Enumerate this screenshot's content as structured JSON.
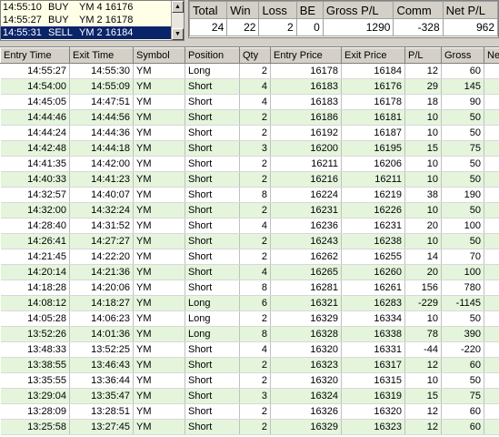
{
  "messages": [
    {
      "time": "14:55:10",
      "side": "BUY",
      "detail": "YM 4 16176",
      "selected": false
    },
    {
      "time": "14:55:27",
      "side": "BUY",
      "detail": "YM 2 16178",
      "selected": false
    },
    {
      "time": "14:55:31",
      "side": "SELL",
      "detail": "YM 2 16184",
      "selected": true
    }
  ],
  "summary": {
    "headers": [
      "Total",
      "Win",
      "Loss",
      "BE",
      "Gross P/L",
      "Comm",
      "Net P/L"
    ],
    "values": [
      "24",
      "22",
      "2",
      "0",
      "1290",
      "-328",
      "962"
    ]
  },
  "trades": {
    "columns": [
      "Entry Time",
      "Exit Time",
      "Symbol",
      "Position",
      "Qty",
      "Entry Price",
      "Exit Price",
      "P/L",
      "Gross",
      "Ne"
    ],
    "rows": [
      [
        "14:55:27",
        "14:55:30",
        "YM",
        "Long",
        "2",
        "16178",
        "16184",
        "12",
        "60",
        ""
      ],
      [
        "14:54:00",
        "14:55:09",
        "YM",
        "Short",
        "4",
        "16183",
        "16176",
        "29",
        "145",
        ""
      ],
      [
        "14:45:05",
        "14:47:51",
        "YM",
        "Short",
        "4",
        "16183",
        "16178",
        "18",
        "90",
        ""
      ],
      [
        "14:44:46",
        "14:44:56",
        "YM",
        "Short",
        "2",
        "16186",
        "16181",
        "10",
        "50",
        ""
      ],
      [
        "14:44:24",
        "14:44:36",
        "YM",
        "Short",
        "2",
        "16192",
        "16187",
        "10",
        "50",
        ""
      ],
      [
        "14:42:48",
        "14:44:18",
        "YM",
        "Short",
        "3",
        "16200",
        "16195",
        "15",
        "75",
        ""
      ],
      [
        "14:41:35",
        "14:42:00",
        "YM",
        "Short",
        "2",
        "16211",
        "16206",
        "10",
        "50",
        ""
      ],
      [
        "14:40:33",
        "14:41:23",
        "YM",
        "Short",
        "2",
        "16216",
        "16211",
        "10",
        "50",
        ""
      ],
      [
        "14:32:57",
        "14:40:07",
        "YM",
        "Short",
        "8",
        "16224",
        "16219",
        "38",
        "190",
        ""
      ],
      [
        "14:32:00",
        "14:32:24",
        "YM",
        "Short",
        "2",
        "16231",
        "16226",
        "10",
        "50",
        ""
      ],
      [
        "14:28:40",
        "14:31:52",
        "YM",
        "Short",
        "4",
        "16236",
        "16231",
        "20",
        "100",
        ""
      ],
      [
        "14:26:41",
        "14:27:27",
        "YM",
        "Short",
        "2",
        "16243",
        "16238",
        "10",
        "50",
        ""
      ],
      [
        "14:21:45",
        "14:22:20",
        "YM",
        "Short",
        "2",
        "16262",
        "16255",
        "14",
        "70",
        ""
      ],
      [
        "14:20:14",
        "14:21:36",
        "YM",
        "Short",
        "4",
        "16265",
        "16260",
        "20",
        "100",
        ""
      ],
      [
        "14:18:28",
        "14:20:06",
        "YM",
        "Short",
        "8",
        "16281",
        "16261",
        "156",
        "780",
        ""
      ],
      [
        "14:08:12",
        "14:18:27",
        "YM",
        "Long",
        "6",
        "16321",
        "16283",
        "-229",
        "-1145",
        "-"
      ],
      [
        "14:05:28",
        "14:06:23",
        "YM",
        "Long",
        "2",
        "16329",
        "16334",
        "10",
        "50",
        ""
      ],
      [
        "13:52:26",
        "14:01:36",
        "YM",
        "Long",
        "8",
        "16328",
        "16338",
        "78",
        "390",
        ""
      ],
      [
        "13:48:33",
        "13:52:25",
        "YM",
        "Short",
        "4",
        "16320",
        "16331",
        "-44",
        "-220",
        ""
      ],
      [
        "13:38:55",
        "13:46:43",
        "YM",
        "Short",
        "2",
        "16323",
        "16317",
        "12",
        "60",
        ""
      ],
      [
        "13:35:55",
        "13:36:44",
        "YM",
        "Short",
        "2",
        "16320",
        "16315",
        "10",
        "50",
        ""
      ],
      [
        "13:29:04",
        "13:35:47",
        "YM",
        "Short",
        "3",
        "16324",
        "16319",
        "15",
        "75",
        ""
      ],
      [
        "13:28:09",
        "13:28:51",
        "YM",
        "Short",
        "2",
        "16326",
        "16320",
        "12",
        "60",
        ""
      ],
      [
        "13:25:58",
        "13:27:45",
        "YM",
        "Short",
        "2",
        "16329",
        "16323",
        "12",
        "60",
        ""
      ]
    ]
  }
}
